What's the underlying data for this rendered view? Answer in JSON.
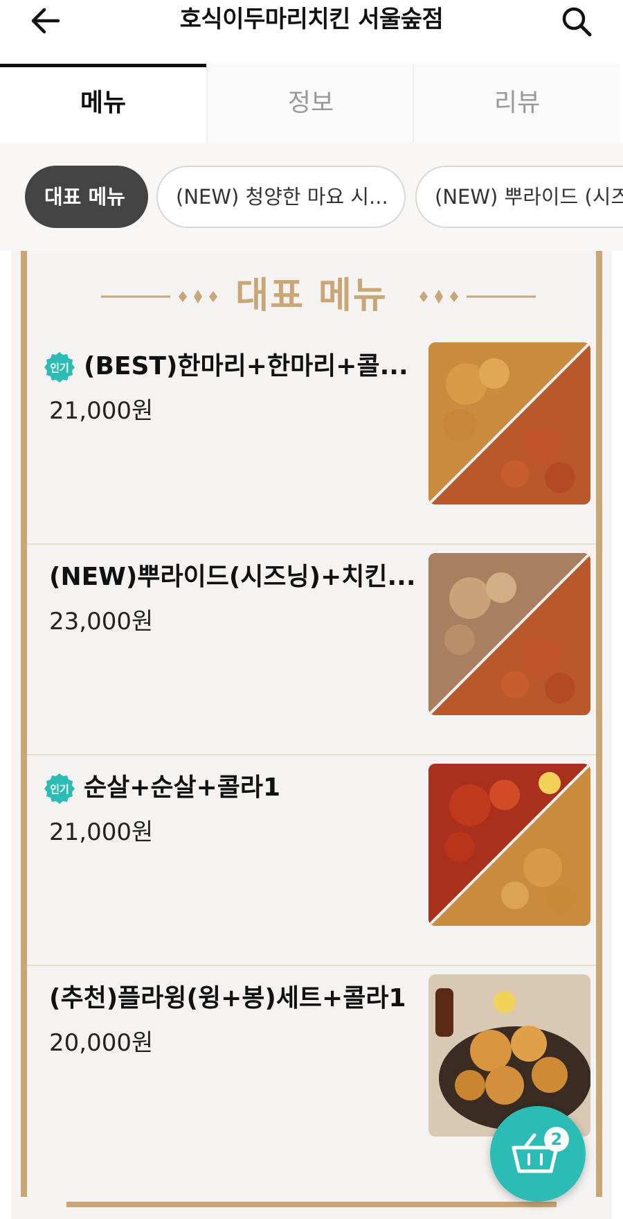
{
  "header": {
    "title": "호식이두마리치킨 서울숲점",
    "back_icon": "arrow-left-icon",
    "search_icon": "search-icon"
  },
  "tabs": [
    {
      "label": "메뉴",
      "active": true
    },
    {
      "label": "정보",
      "active": false
    },
    {
      "label": "리뷰",
      "active": false
    }
  ],
  "categories": [
    {
      "label": "대표 메뉴",
      "active": true
    },
    {
      "label": "(NEW) 청양한 마요 시...",
      "active": false
    },
    {
      "label": "(NEW) 뿌라이드 (시즈",
      "active": false
    }
  ],
  "section": {
    "title": "대표 메뉴"
  },
  "menu_items": [
    {
      "name": "(BEST)한마리+한마리+콜...",
      "price": "21,000원",
      "badge": "인기"
    },
    {
      "name": "(NEW)뿌라이드(시즈닝)+치킨...",
      "price": "23,000원",
      "badge": ""
    },
    {
      "name": "순살+순살+콜라1",
      "price": "21,000원",
      "badge": "인기"
    },
    {
      "name": "(추천)플라윙(윙+봉)세트+콜라1",
      "price": "20,000원",
      "badge": ""
    }
  ],
  "cart": {
    "count": "2",
    "icon": "cart-icon"
  },
  "colors": {
    "accent_gold": "#c8a676",
    "badge_teal": "#2cbcb6",
    "chip_active": "#444444"
  }
}
